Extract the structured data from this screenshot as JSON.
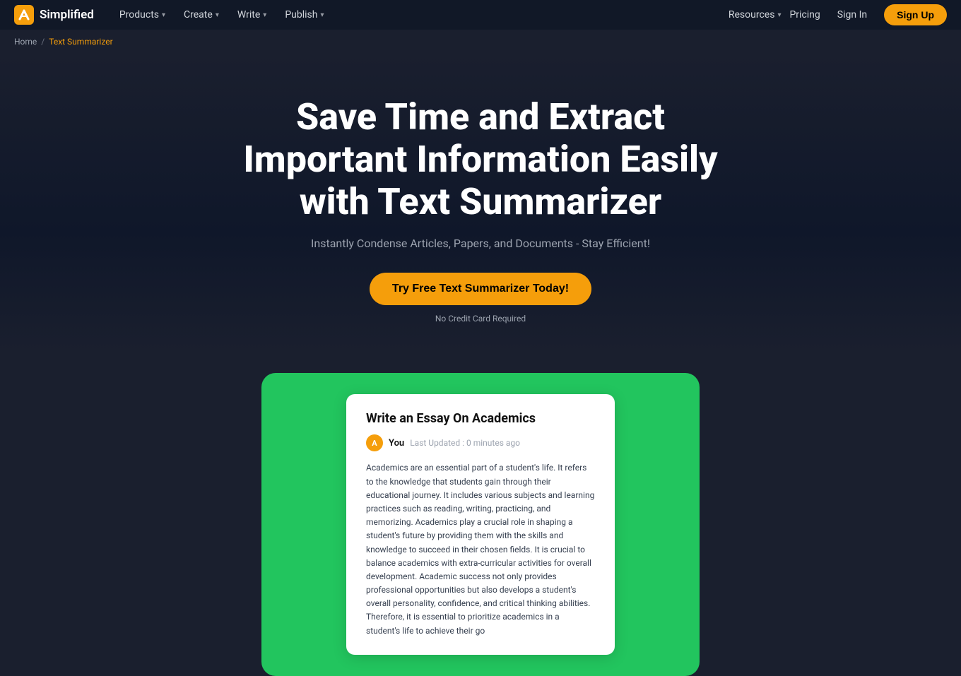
{
  "brand": {
    "name": "Simplified",
    "logo_alt": "Simplified logo"
  },
  "nav": {
    "items": [
      {
        "label": "Products",
        "has_dropdown": true
      },
      {
        "label": "Create",
        "has_dropdown": true
      },
      {
        "label": "Write",
        "has_dropdown": true
      },
      {
        "label": "Publish",
        "has_dropdown": true
      }
    ],
    "right_items": [
      {
        "label": "Resources",
        "has_dropdown": true
      },
      {
        "label": "Pricing",
        "has_dropdown": false
      },
      {
        "label": "Sign In",
        "has_dropdown": false
      },
      {
        "label": "Sign Up",
        "is_cta": true
      }
    ]
  },
  "breadcrumb": {
    "home": "Home",
    "separator": "/",
    "current": "Text Summarizer"
  },
  "hero": {
    "title": "Save Time and Extract Important Information Easily with Text Summarizer",
    "subtitle": "Instantly Condense Articles, Papers, and Documents - Stay Efficient!",
    "cta_label": "Try Free Text Summarizer Today!",
    "no_cc_text": "No Credit Card Required"
  },
  "demo": {
    "card_title": "Write an Essay On Academics",
    "avatar_letter": "A",
    "meta_you": "You",
    "meta_time": "Last Updated : 0 minutes ago",
    "body_text": "Academics are an essential part of a student's life. It refers to the knowledge that students gain through their educational journey. It includes various subjects and learning practices such as reading, writing, practicing, and memorizing. Academics play a crucial role in shaping a student's future by providing them with the skills and knowledge to succeed in their chosen fields. It is crucial to balance academics with extra-curricular activities for overall development. Academic success not only provides professional opportunities but also develops a student's overall personality, confidence, and critical thinking abilities. Therefore, it is essential to prioritize academics in a student's life to achieve their go"
  }
}
